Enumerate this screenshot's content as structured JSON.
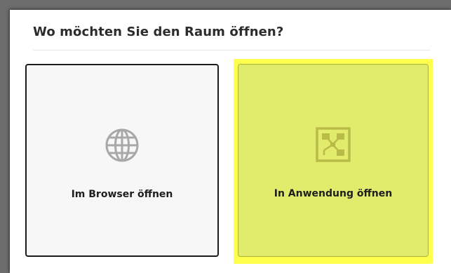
{
  "dialog": {
    "title": "Wo möchten Sie den Raum öffnen?"
  },
  "options": [
    {
      "label": "Im Browser öffnen",
      "icon": "globe-icon",
      "selected": false
    },
    {
      "label": "In Anwendung öffnen",
      "icon": "application-icon",
      "selected": true
    }
  ],
  "colors": {
    "backdrop": "#6d6d6d",
    "dialog_bg": "#ffffff",
    "browser_card_bg": "#f7f7f7",
    "browser_card_border": "#1b1b1b",
    "app_card_bg": "#e2ec6c",
    "highlight": "#ffff4d",
    "icon_gray": "#a8a8a8",
    "app_icon": "#b8bb48"
  }
}
